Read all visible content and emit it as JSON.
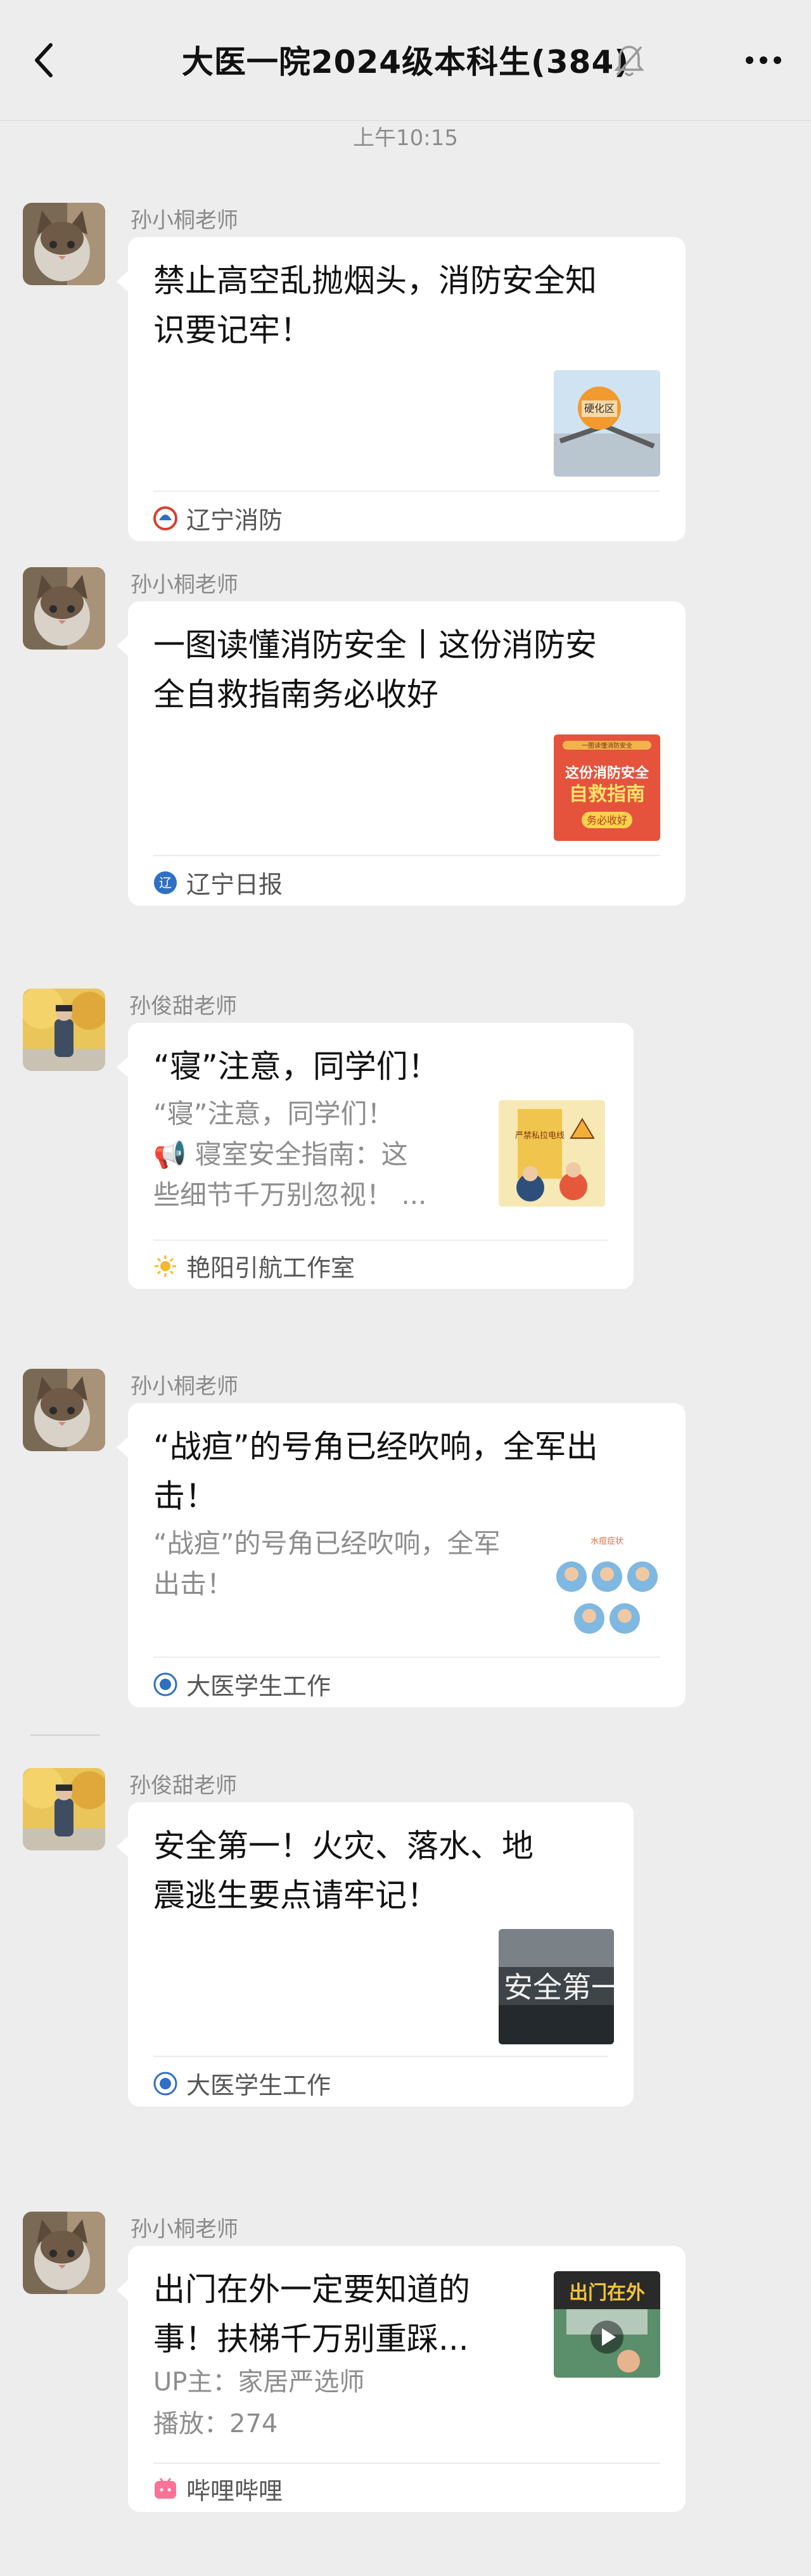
{
  "header": {
    "title": "大医一院2024级本科生(384)",
    "back_icon": "chevron-left-icon",
    "mute_icon": "bell-off-icon",
    "more_icon": "more-dots-icon"
  },
  "timestamp": "上午10:15",
  "messages": [
    {
      "sender": "孙小桐老师",
      "title_lines": [
        "禁止高空乱抛烟头，消防安全知",
        "识要记牢！"
      ],
      "thumb_text": "硬化区",
      "source": "辽宁消防"
    },
    {
      "sender": "孙小桐老师",
      "title_lines": [
        "一图读懂消防安全丨这份消防安",
        "全自救指南务必收好"
      ],
      "thumb_text_lines": [
        "一图读懂消防安全",
        "这份消防安全",
        "自救指南",
        "务必收好"
      ],
      "source": "辽宁日报"
    },
    {
      "sender": "孙俊甜老师",
      "title_lines": [
        "“寝”注意，同学们！"
      ],
      "desc_lines": [
        "“寝”注意，同学们！",
        "📢 寝室安全指南：这",
        "些细节千万别忽视！ ..."
      ],
      "thumb_text": "严禁私拉电线",
      "source": "艳阳引航工作室"
    },
    {
      "sender": "孙小桐老师",
      "title_lines": [
        "“战疸”的号角已经吹响，全军出",
        "击！"
      ],
      "desc_lines": [
        "“战疸”的号角已经吹响，全军",
        "出击！"
      ],
      "thumb_text": "水痘症状",
      "source": "大医学生工作"
    },
    {
      "sender": "孙俊甜老师",
      "title_lines": [
        "安全第一！火灾、落水、地",
        "震逃生要点请牢记！"
      ],
      "thumb_text": "安全第一",
      "source": "大医学生工作"
    },
    {
      "sender": "孙小桐老师",
      "title_lines": [
        "出门在外一定要知道的",
        "事！扶梯千万别重踩..."
      ],
      "desc_lines": [
        "UP主：家居严选师",
        "播放：274"
      ],
      "thumb_text": "出门在外",
      "source": "哔哩哔哩"
    }
  ],
  "colors": {
    "background": "#ededed",
    "card": "#ffffff",
    "secondary_text": "#8d8d8d",
    "bilibili_pink": "#fb7299",
    "liaoning_blue": "#2f6fc4"
  }
}
